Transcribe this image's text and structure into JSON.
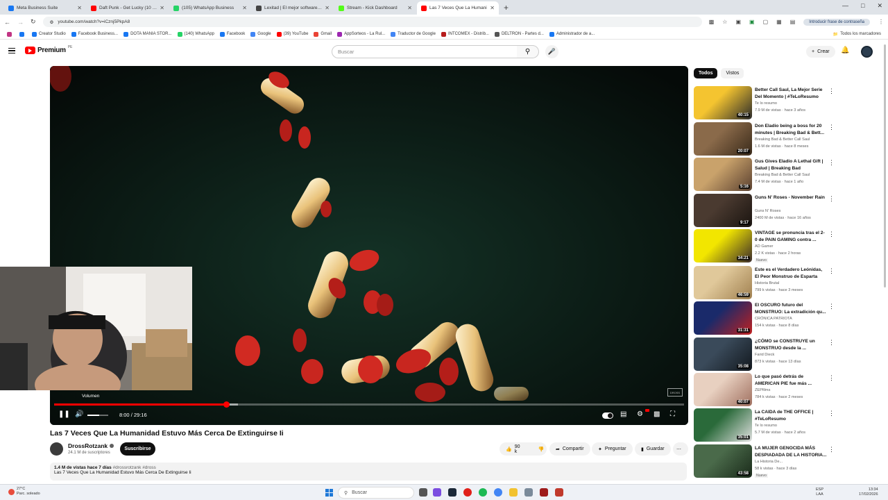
{
  "browser": {
    "tabs": [
      {
        "label": "Meta Business Suite",
        "color": "#1877f2"
      },
      {
        "label": "Daft Punk - Get Lucky (10 min",
        "color": "#ff0000"
      },
      {
        "label": "(105) WhatsApp Business",
        "color": "#25d366"
      },
      {
        "label": "Lexitad | El mejor software para",
        "color": "#444444"
      },
      {
        "label": "Stream - Kick Dashboard",
        "color": "#53fc18"
      },
      {
        "label": "Las 7 Veces Que La Humani",
        "color": "#ff0000"
      }
    ],
    "url": "youtube.com/watch?v=iCznj5PkpA8",
    "password_prompt": "Introducir frase de contraseña",
    "bookmarks": [
      {
        "label": "",
        "color": "#c13584"
      },
      {
        "label": "",
        "color": "#1877f2"
      },
      {
        "label": "Creator Studio",
        "color": "#1877f2"
      },
      {
        "label": "Facebook Business...",
        "color": "#1877f2"
      },
      {
        "label": "DOTA MANIA STOR...",
        "color": "#1877f2"
      },
      {
        "label": "(140) WhatsApp",
        "color": "#25d366"
      },
      {
        "label": "Facebook",
        "color": "#1877f2"
      },
      {
        "label": "Google",
        "color": "#4285f4"
      },
      {
        "label": "(39) YouTube",
        "color": "#ff0000"
      },
      {
        "label": "Gmail",
        "color": "#ea4335"
      },
      {
        "label": "AppSorteos - La Rul...",
        "color": "#9c27b0"
      },
      {
        "label": "Traductor de Google",
        "color": "#4285f4"
      },
      {
        "label": "INTCOMEX - Distrib...",
        "color": "#b71c1c"
      },
      {
        "label": "DELTRON - Partes d...",
        "color": "#555555"
      },
      {
        "label": "Administrador de a...",
        "color": "#1877f2"
      }
    ],
    "all_bookmarks": "Todos los marcadores"
  },
  "youtube": {
    "logo": "Premium",
    "logo_country": "PE",
    "search_placeholder": "Buscar",
    "create_label": "Crear"
  },
  "player": {
    "current_time": "8:00",
    "duration": "29:16",
    "progress_fraction": 0.273,
    "buffer_fraction": 0.292,
    "volume_fraction": 0.55,
    "volume_tooltip": "Volumen",
    "watermark": "DROSS"
  },
  "video": {
    "title": "Las 7 Veces Que La Humanidad Estuvo Más Cerca De Extinguirse Ii",
    "channel": "DrossRotzank",
    "subscribers": "24.1 M de suscriptores",
    "subscribe_label": "Suscribirse",
    "likes": "90 k",
    "share_label": "Compartir",
    "ask_label": "Preguntar",
    "save_label": "Guardar",
    "description_meta": "1.4 M de vistas  hace 7 días",
    "description_tags": "#drossrotzank #dross",
    "description_text": "Las 7 Veces Que La Humanidad Estuvo Más Cerca De Extinguirse Ii"
  },
  "sidebar": {
    "chips": [
      "Todos",
      "Vistos"
    ],
    "recommendations": [
      {
        "title": "Better Call Saul, La Mejor Serie Del Momento | #TeLoResumo",
        "channel": "Te lo resumo",
        "meta": "7.9 M de vistas · hace 3 años",
        "duration": "40:15",
        "new": "",
        "colors": [
          "#f4c430",
          "#2b2b2b"
        ]
      },
      {
        "title": "Don Eladio being a boss for 20 minutes | Breaking Bad & Bett...",
        "channel": "Breaking Bad & Better Call Saul",
        "meta": "1.6 M de vistas · hace 8 meses",
        "duration": "20:07",
        "new": "",
        "colors": [
          "#8a6a4a",
          "#3a2a1a"
        ]
      },
      {
        "title": "Gus Gives Eladio A Lethal Gift | Salud | Breaking Bad",
        "channel": "Breaking Bad & Better Call Saul",
        "meta": "7.4 M de vistas · hace 1 año",
        "duration": "5:16",
        "new": "",
        "colors": [
          "#c9a26b",
          "#5a4030"
        ]
      },
      {
        "title": "Guns N' Roses - November Rain",
        "channel": "Guns N' Roses",
        "meta": "2400 M de vistas · hace 16 años",
        "duration": "9:17",
        "new": "",
        "colors": [
          "#4a3a30",
          "#1a1410"
        ]
      },
      {
        "title": "VINTAGE se pronuncia tras el 2-0 de PAIN GAMING contra ...",
        "channel": "AD Gamer",
        "meta": "2.2 K vistas · hace 2 horas",
        "duration": "34:21",
        "new": "Nuevo",
        "colors": [
          "#f2e600",
          "#3a2a2a"
        ]
      },
      {
        "title": "Este es el Verdadero Leónidas, El Peor Monstruo de Esparta",
        "channel": "Historia Brutal",
        "meta": "799 k vistas · hace 3 meses",
        "duration": "46:59",
        "new": "",
        "colors": [
          "#e0c89a",
          "#a08050"
        ]
      },
      {
        "title": "El OSCURO futuro del MONSTRUO: La extradición qu...",
        "channel": "CRÓNICA PATRIOTA",
        "meta": "154 k vistas · hace 8 días",
        "duration": "31:31",
        "new": "",
        "colors": [
          "#1a2a6a",
          "#c02020"
        ]
      },
      {
        "title": "¿CÓMO se CONSTRUYE un MONSTRUO desde la ...",
        "channel": "Farid Dieck",
        "meta": "873 k vistas · hace 13 días",
        "duration": "35:08",
        "new": "",
        "colors": [
          "#3a4a5a",
          "#12181e"
        ]
      },
      {
        "title": "Lo que pasó detrás de AMERICAN PIE fue más ...",
        "channel": "ZEPfilms",
        "meta": "784 k vistas · hace 2 meses",
        "duration": "40:07",
        "new": "",
        "colors": [
          "#e8d0c0",
          "#a07060"
        ]
      },
      {
        "title": "La CAIDA de THE OFFICE | #TeLoResumo",
        "channel": "Te lo resumo",
        "meta": "5.7 M de vistas · hace 2 años",
        "duration": "35:01",
        "new": "",
        "colors": [
          "#2a6a3a",
          "#e0e0e0"
        ]
      },
      {
        "title": "LA MUJER GENOCIDA MÁS DESPIADADA DE LA HISTORIA...",
        "channel": "La Historia De...",
        "meta": "58 k vistas · hace 3 días",
        "duration": "43:58",
        "new": "Nuevo",
        "colors": [
          "#4a6a4a",
          "#1a2a1a"
        ]
      }
    ]
  },
  "taskbar": {
    "weather_temp": "27°C",
    "weather_desc": "Parc. soleado",
    "search_label": "Buscar",
    "lang": "ESP",
    "lang2": "LAA",
    "time": "13:34",
    "date": "17/02/2026"
  }
}
